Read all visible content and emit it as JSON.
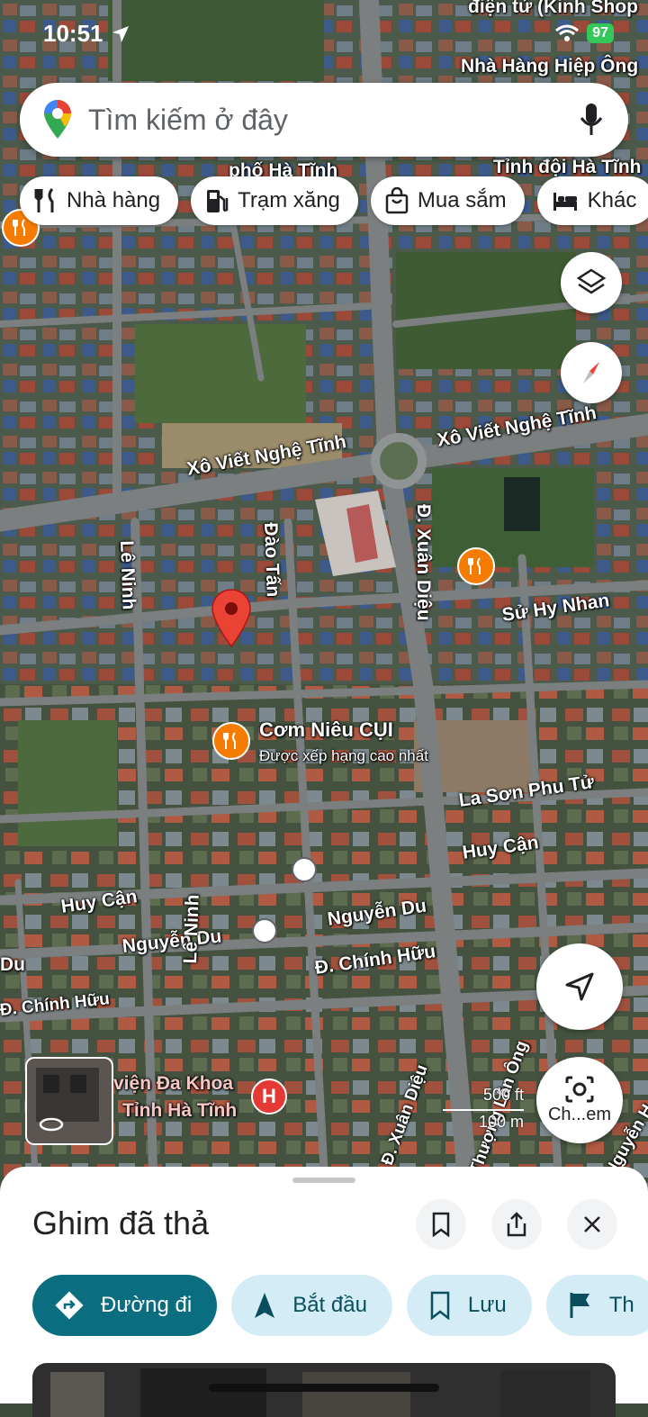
{
  "status_bar": {
    "time": "10:51",
    "battery": "97"
  },
  "search": {
    "placeholder": "Tìm kiếm ở đây"
  },
  "chips": [
    {
      "label": "Nhà hàng",
      "icon": "restaurant-icon"
    },
    {
      "label": "Trạm xăng",
      "icon": "gas-station-icon"
    },
    {
      "label": "Mua sắm",
      "icon": "shopping-bag-icon"
    },
    {
      "label": "Khác",
      "icon": "hotel-icon"
    }
  ],
  "map": {
    "labels": {
      "top_shop": "điện tử (Kinh Shop",
      "restaurant_hiep": "Nhà Hàng Hiệp Ông",
      "pho_ha_tinh": "phố Hà Tĩnh",
      "tinh_doi": "Tỉnh đội Hà Tĩnh",
      "xvnt_right": "Xô Viết Nghệ Tĩnh",
      "xvnt_left": "Xô Viết Nghệ Tĩnh",
      "dao_tan": "Đào Tấn",
      "le_ninh_top": "Lê Ninh",
      "xuan_dieu": "Đ. Xuân Diệu",
      "su_hy_nhan": "Sử Hy Nhan",
      "com_nieu": "Cơm Niêu CỤI",
      "com_nieu_sub": "Được xếp hạng cao nhất",
      "la_son": "La Sơn Phu Tử",
      "huy_can_right": "Huy Cận",
      "huy_can_left": "Huy Cận",
      "nguyen_du_right": "Nguyễn Du",
      "nguyen_du_left": "Nguyễn Du",
      "chinh_huu_right": "Đ. Chính Hữu",
      "chinh_huu_left": "Đ. Chính Hữu",
      "du_left": "Du",
      "le_ninh_bottom": "Lê Ninh",
      "hospital_1": "viện Đa Khoa",
      "hospital_2": "Tỉnh Hà Tĩnh",
      "xuan_dieu_bottom": "Đ. Xuân Diệu",
      "thuong_tan_ong": "Thượng Lãn Ông",
      "nguyen_right": "Nguyễn H"
    },
    "scale": {
      "ft": "500 ft",
      "m": "100 m"
    },
    "lens_label": "Ch...em"
  },
  "sheet": {
    "title": "Ghim đã thả",
    "actions": [
      {
        "label": "Đường đi",
        "icon": "directions-icon"
      },
      {
        "label": "Bắt đầu",
        "icon": "navigation-arrow-icon"
      },
      {
        "label": "Lưu",
        "icon": "bookmark-icon"
      },
      {
        "label": "Th",
        "icon": "flag-icon"
      }
    ]
  },
  "colors": {
    "accent": "#0b6e80",
    "pin": "#ea4335",
    "poi": "#f57c00",
    "action_bg": "#d3ecf5"
  }
}
